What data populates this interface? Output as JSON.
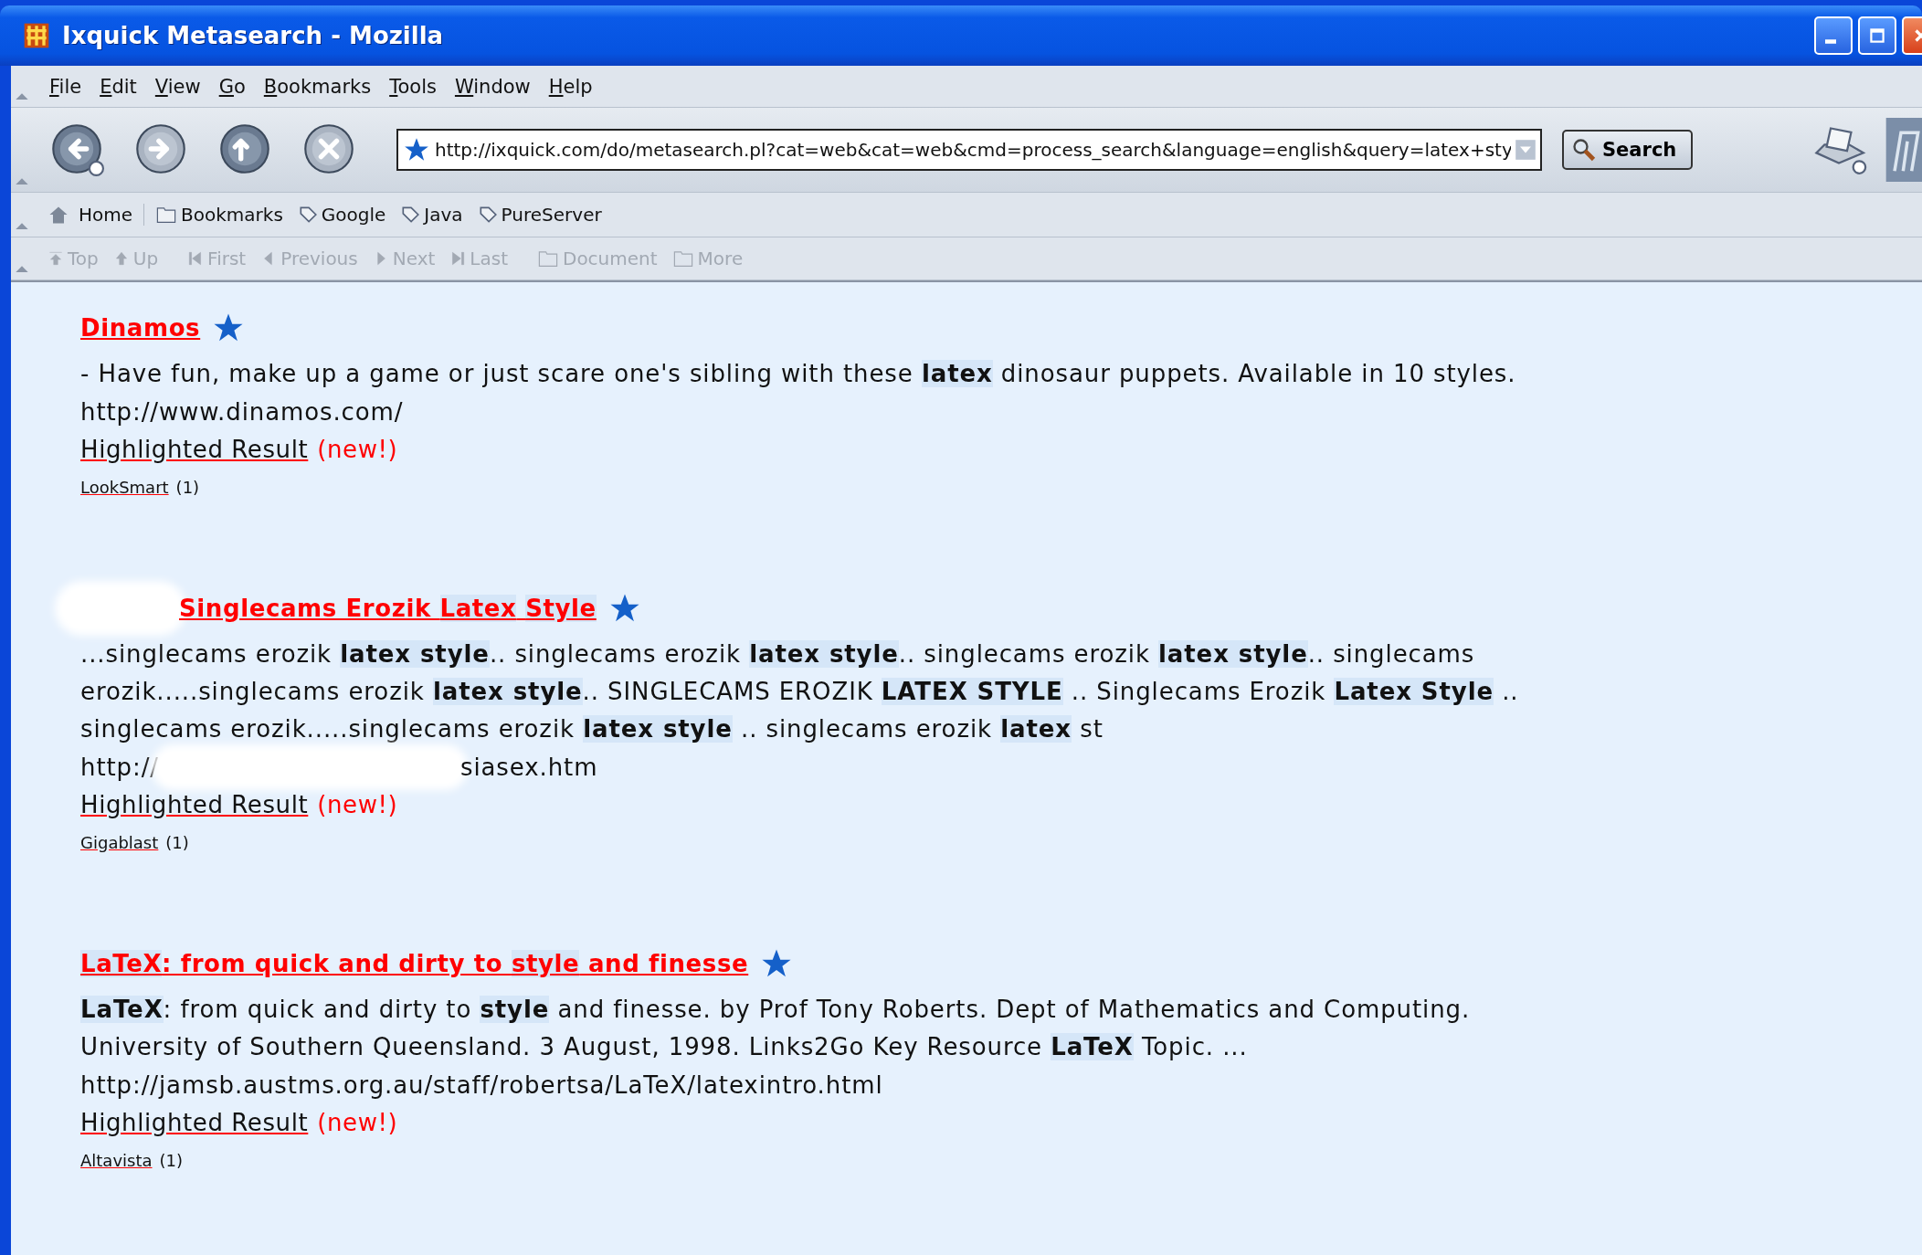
{
  "window": {
    "title": "Ixquick Metasearch - Mozilla"
  },
  "menu": [
    {
      "label": "File"
    },
    {
      "label": "Edit"
    },
    {
      "label": "View"
    },
    {
      "label": "Go"
    },
    {
      "label": "Bookmarks"
    },
    {
      "label": "Tools"
    },
    {
      "label": "Window"
    },
    {
      "label": "Help"
    }
  ],
  "nav_buttons": [
    {
      "kind": "back",
      "disabled": false
    },
    {
      "kind": "forward",
      "disabled": true
    },
    {
      "kind": "reload",
      "disabled": false
    },
    {
      "kind": "stop",
      "disabled": true
    }
  ],
  "address_bar": {
    "value": "http://ixquick.com/do/metasearch.pl?cat=web&cat=web&cmd=process_search&language=english&query=latex+sty"
  },
  "search_button": "Search",
  "personal_toolbar": [
    {
      "kind": "home",
      "label": "Home"
    },
    {
      "kind": "folder",
      "label": "Bookmarks"
    },
    {
      "kind": "bookmark",
      "label": "Google"
    },
    {
      "kind": "bookmark",
      "label": "Java"
    },
    {
      "kind": "bookmark",
      "label": "PureServer"
    }
  ],
  "site_navigation": [
    {
      "kind": "top",
      "label": "Top",
      "disabled": true
    },
    {
      "kind": "up",
      "label": "Up",
      "disabled": true
    },
    {
      "kind": "first",
      "label": "First",
      "disabled": true
    },
    {
      "kind": "previous",
      "label": "Previous",
      "disabled": true
    },
    {
      "kind": "next",
      "label": "Next",
      "disabled": true
    },
    {
      "kind": "last",
      "label": "Last",
      "disabled": true
    },
    {
      "kind": "folder",
      "label": "Document",
      "disabled": true
    },
    {
      "kind": "folder",
      "label": "More",
      "disabled": true
    }
  ],
  "results": [
    {
      "title": "Dinamos",
      "redacted": false,
      "snippet": "- Have fun, make up a game or just scare one's sibling with these **latex** dinosaur puppets. Available in 10 styles.",
      "url_parts": [
        "http://www.dinamos.com/"
      ],
      "highlight_link": "Highlighted Result",
      "new_label": "(new!)",
      "source": "LookSmart",
      "source_count": "(1)"
    },
    {
      "title": "Singlecams Erozik **Latex** **Style**",
      "redacted": true,
      "snippet": "...singlecams erozik **latex style**.. singlecams erozik **latex style**.. singlecams erozik **latex style**.. singlecams erozik.....singlecams erozik **latex style**.. SINGLECAMS EROZIK **LATEX STYLE** .. Singlecams Erozik **Latex Style** .. singlecams erozik.....singlecams erozik **latex style** .. singlecams erozik **latex** st",
      "url_parts": [
        "http://",
        "siasex.htm"
      ],
      "highlight_link": "Highlighted Result",
      "new_label": "(new!)",
      "source": "Gigablast",
      "source_count": "(1)"
    },
    {
      "title": "**LaTeX**: from quick and dirty to **style** and finesse",
      "redacted": false,
      "snippet": "**LaTeX**: from quick and dirty to **style** and finesse. by Prof Tony Roberts. Dept of Mathematics and Computing. University of Southern Queensland. 3 August, 1998. Links2Go Key Resource **LaTeX** Topic. ...",
      "url_parts": [
        "http://jamsb.austms.org.au/staff/robertsa/LaTeX/latexintro.html"
      ],
      "highlight_link": "Highlighted Result",
      "new_label": "(new!)",
      "source": "Altavista",
      "source_count": "(1)"
    }
  ]
}
